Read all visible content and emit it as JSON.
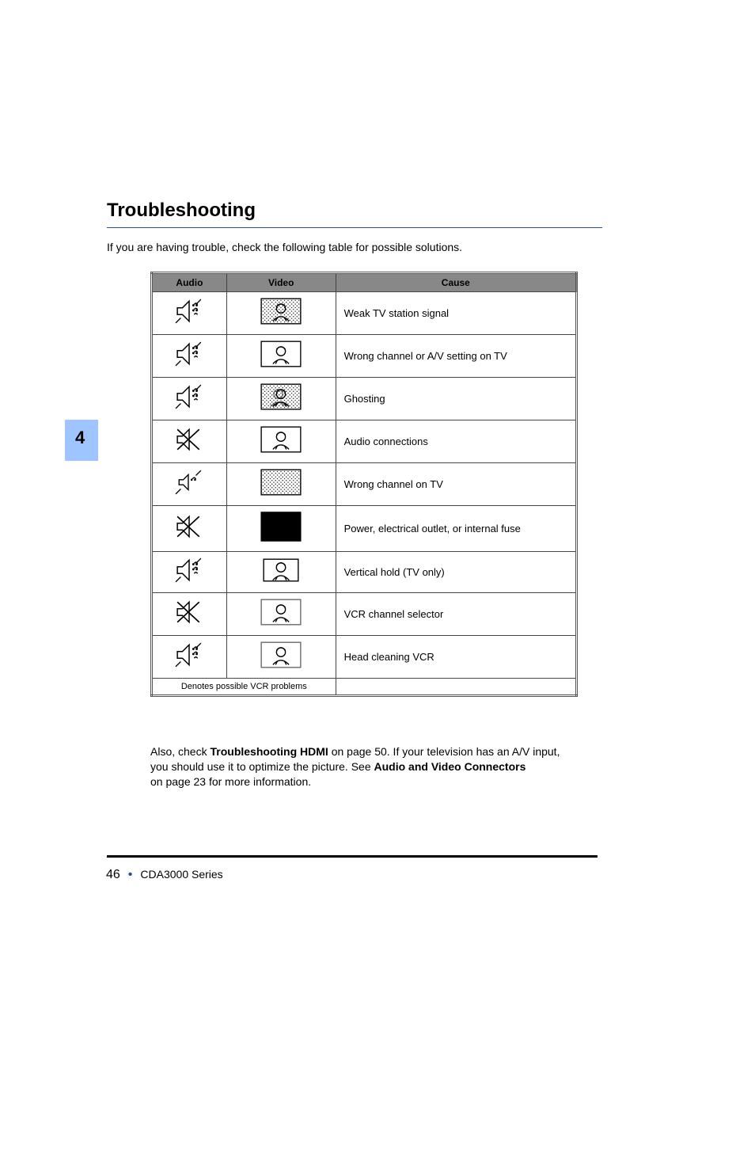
{
  "sideTab": "4",
  "heading": "Troubleshooting",
  "intro": "If you are having trouble, check the following table for possible solutions.",
  "table": {
    "headers": {
      "audio": "Audio",
      "video": "Video",
      "cause": "Cause"
    },
    "rows": [
      {
        "audio": "speaker-notes-icon",
        "video": "person-frame-dotted-icon",
        "cause": "Weak TV station signal"
      },
      {
        "audio": "speaker-notes-icon",
        "video": "person-frame-icon",
        "cause": "Wrong channel or A/V setting on TV"
      },
      {
        "audio": "speaker-notes-icon",
        "video": "person-frame-ghost-icon",
        "cause": "Ghosting"
      },
      {
        "audio": "speaker-x-icon",
        "video": "person-frame-icon",
        "cause": "Audio connections"
      },
      {
        "audio": "speaker-small-icon",
        "video": "snow-frame-icon",
        "cause": "Wrong channel on TV"
      },
      {
        "audio": "speaker-x-icon",
        "video": "black-frame-icon",
        "cause": "Power, electrical outlet, or internal fuse"
      },
      {
        "audio": "speaker-notes-icon",
        "video": "person-frame-small-icon",
        "cause": "Vertical hold (TV only)"
      },
      {
        "audio": "speaker-x-icon",
        "video": "person-frame-gray-icon",
        "cause": "VCR channel selector"
      },
      {
        "audio": "speaker-notes-icon",
        "video": "person-frame-gray-icon",
        "cause": "Head cleaning VCR"
      }
    ],
    "mergeNote": "Denotes possible VCR problems"
  },
  "outro": {
    "line1_pre": "Also, check ",
    "line1_bold": "Troubleshooting HDMI",
    "line1_post": " on page 50. If your television has an A/V input,",
    "line2_pre": "you should use it to optimize the picture. See ",
    "line2_bold": "Audio and Video Connectors",
    "line3": "on page 23 for more information."
  },
  "footer": {
    "page": "46",
    "series": "CDA3000 Series"
  }
}
